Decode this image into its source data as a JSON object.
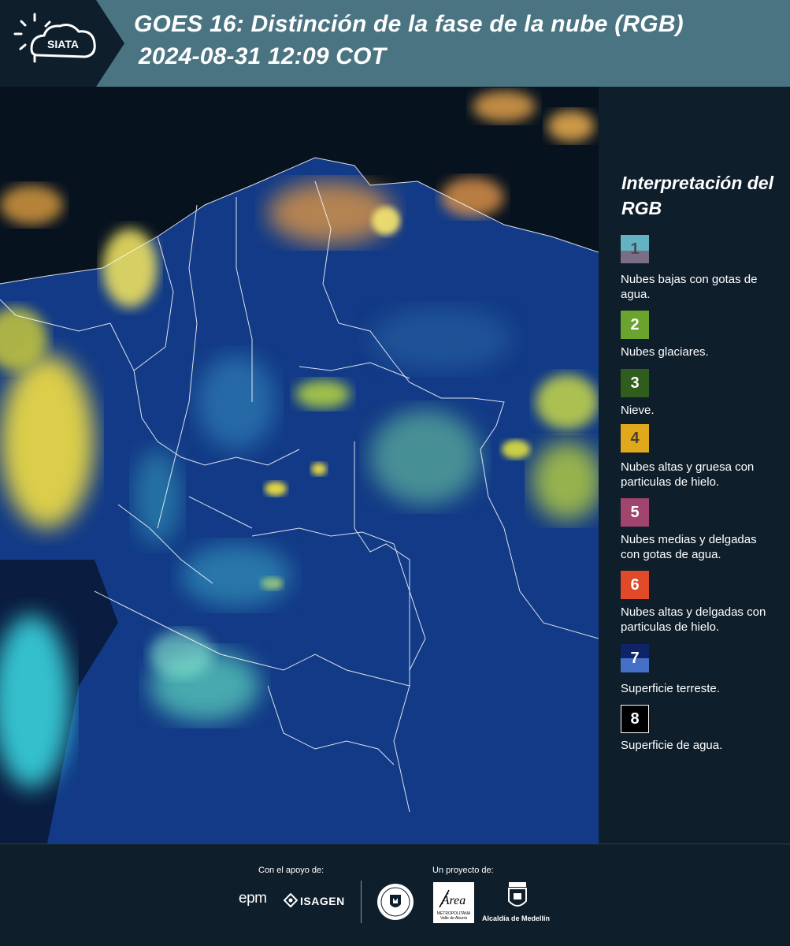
{
  "header": {
    "logo_text": "SIATA",
    "title_line1": "GOES 16: Distinción de la fase de la nube (RGB)",
    "title_line2": "2024-08-31 12:09 COT"
  },
  "legend": {
    "title": "Interpretación del RGB",
    "items": [
      {
        "number": "1",
        "label": "Nubes bajas con gotas de agua.",
        "color_top": "#63b3c3",
        "color_bottom": "#7a6e86"
      },
      {
        "number": "2",
        "label": "Nubes glaciares.",
        "color": "#6aa32e"
      },
      {
        "number": "3",
        "label": "Nieve.",
        "color": "#2e5d1e"
      },
      {
        "number": "4",
        "label": "Nubes altas y gruesa con particulas de hielo.",
        "color": "#e0a91c"
      },
      {
        "number": "5",
        "label": "Nubes medias y delgadas con gotas de agua.",
        "color": "#a0466e"
      },
      {
        "number": "6",
        "label": "Nubes altas y delgadas con particulas de hielo.",
        "color": "#e04a28"
      },
      {
        "number": "7",
        "label": "Superficie terreste.",
        "color_top": "#0f2468",
        "color_bottom": "#4470c8"
      },
      {
        "number": "8",
        "label": "Superficie de agua.",
        "color": "#000000"
      }
    ]
  },
  "footer": {
    "support_label": "Con el apoyo de:",
    "project_label": "Un proyecto de:",
    "sponsor_1": "epm",
    "sponsor_2": "ISAGEN",
    "partner_2_text": "Área",
    "partner_2_sub": "METROPOLITANA Valle de Aburrá",
    "partner_3": "Alcaldía de Medellín"
  },
  "colors": {
    "header_bg": "#4a7482",
    "panel_bg": "#0e1e2b",
    "ocean": "#07121f",
    "land": "#123a86"
  }
}
